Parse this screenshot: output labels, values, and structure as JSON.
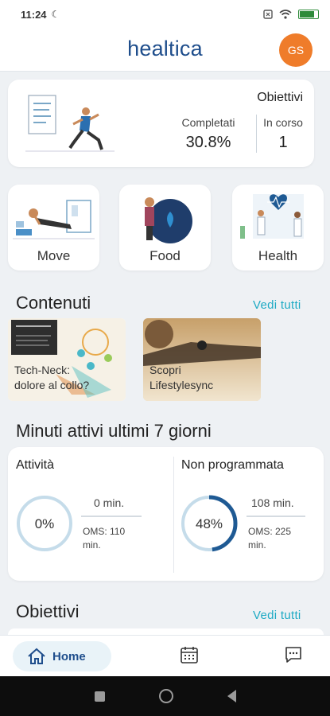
{
  "status": {
    "time": "11:24",
    "moon": "☾"
  },
  "header": {
    "logo": "healtica",
    "avatar_initials": "GS"
  },
  "goals": {
    "title": "Obiettivi",
    "completed_label": "Completati",
    "completed_value": "30.8%",
    "in_progress_label": "In corso",
    "in_progress_value": "1"
  },
  "categories": [
    {
      "label": "Move"
    },
    {
      "label": "Food"
    },
    {
      "label": "Health"
    }
  ],
  "contents": {
    "title": "Contenuti",
    "see_all": "Vedi tutti",
    "items": [
      {
        "line1": "Tech-Neck:",
        "line2": "dolore al collo?"
      },
      {
        "line1": "Scopri",
        "line2": "Lifestylesync"
      }
    ]
  },
  "minutes": {
    "title": "Minuti attivi ultimi 7 giorni",
    "activity": {
      "label": "Attività",
      "percent_text": "0%",
      "value": "0 min.",
      "oms_line1": "OMS: 110",
      "oms_line2": "min.",
      "progress": 0
    },
    "unplanned": {
      "label": "Non programmata",
      "percent_text": "48%",
      "value": "108 min.",
      "oms_line1": "OMS: 225",
      "oms_line2": "min.",
      "progress": 0.48
    }
  },
  "objectives": {
    "title": "Obiettivi",
    "see_all": "Vedi tutti"
  },
  "bottom_nav": {
    "home_label": "Home"
  },
  "colors": {
    "accent": "#1f4e8c",
    "link": "#1eaac4",
    "avatar": "#ef7c2a",
    "ring_track": "#c5dcea",
    "ring_fill": "#1f5a94"
  }
}
